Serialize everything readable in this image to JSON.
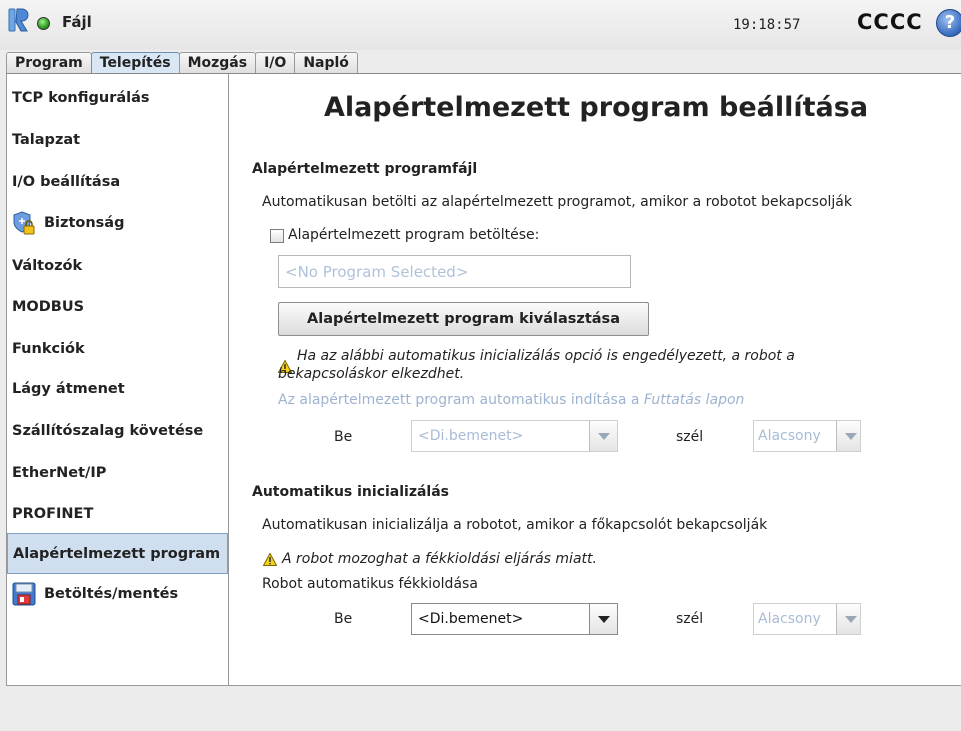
{
  "header": {
    "file_menu": "Fájl",
    "clock": "19:18:57",
    "robot_name": "CCCC",
    "help_label": "?",
    "status_color": "#2d9a1e"
  },
  "tabs": [
    {
      "label": "Program"
    },
    {
      "label": "Telepítés"
    },
    {
      "label": "Mozgás"
    },
    {
      "label": "I/O"
    },
    {
      "label": "Napló"
    }
  ],
  "sidebar": {
    "items": [
      {
        "label": "TCP konfigurálás"
      },
      {
        "label": "Talapzat"
      },
      {
        "label": "I/O beállítása"
      },
      {
        "label": "Biztonság",
        "icon": "shield-lock-icon"
      },
      {
        "label": "Változók"
      },
      {
        "label": "MODBUS"
      },
      {
        "label": "Funkciók"
      },
      {
        "label": "Lágy átmenet"
      },
      {
        "label": "Szállítószalag követése"
      },
      {
        "label": "EtherNet/IP"
      },
      {
        "label": "PROFINET"
      },
      {
        "label": "Alapértelmezett program"
      },
      {
        "label": "Betöltés/mentés",
        "icon": "floppy-disk-icon"
      }
    ]
  },
  "main": {
    "title": "Alapértelmezett program beállítása",
    "default_file": {
      "section_title": "Alapértelmezett programfájl",
      "description": "Automatikusan betölti az alapértelmezett programot, amikor a robotot bekapcsolják",
      "checkbox_label": "Alapértelmezett program betöltése:",
      "checked": false,
      "program_field_value": "<No Program Selected>",
      "select_button": "Alapértelmezett program kiválasztása",
      "warning_line1": "Ha az alábbi automatikus inicializálás opció is engedélyezett, a robot a",
      "warning_line2": "bekapcsoláskor elkezdhet.",
      "autostart_prefix": "Az alapértelmezett program automatikus indítása a ",
      "autostart_link": "Futtatás lapon",
      "be_label": "Be",
      "input_value": "<Di.bemenet>",
      "edge_label": "szél",
      "level_value": "Alacsony"
    },
    "auto_init": {
      "section_title": "Automatikus inicializálás",
      "description": "Automatikusan inicializálja a robotot, amikor a főkapcsolót bekapcsolják",
      "warning": "A robot mozoghat a fékkioldási eljárás miatt.",
      "brake_release_label": "Robot automatikus fékkioldása",
      "be_label": "Be",
      "input_value": "<Di.bemenet>",
      "edge_label": "szél",
      "level_value": "Alacsony"
    }
  }
}
